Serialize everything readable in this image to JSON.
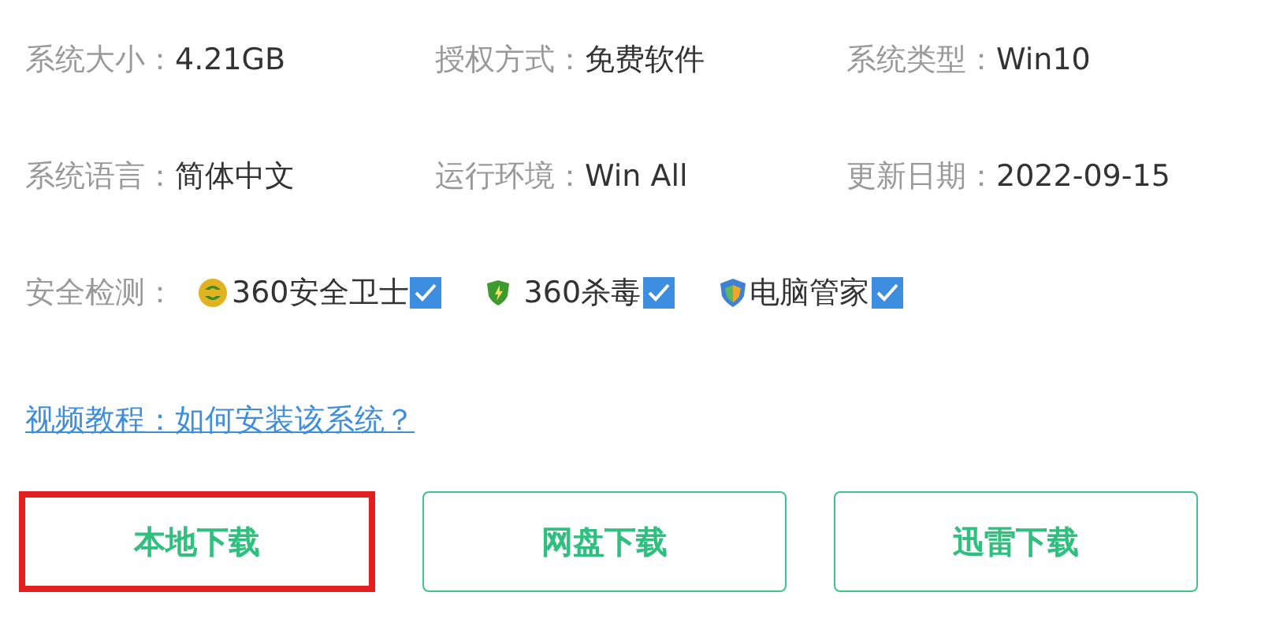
{
  "info_rows": [
    [
      {
        "label": "系统大小：",
        "value": "4.21GB"
      },
      {
        "label": "授权方式：",
        "value": "免费软件"
      },
      {
        "label": "系统类型：",
        "value": "Win10"
      }
    ],
    [
      {
        "label": "系统语言：",
        "value": "简体中文"
      },
      {
        "label": "运行环境：",
        "value": "Win All"
      },
      {
        "label": "更新日期：",
        "value": "2022-09-15"
      }
    ]
  ],
  "security": {
    "label": "安全检测：",
    "items": [
      {
        "kind": "guard",
        "name": "360安全卫士",
        "checked": true
      },
      {
        "kind": "antivirus",
        "name": "360杀毒",
        "checked": true
      },
      {
        "kind": "manager",
        "name": "电脑管家",
        "checked": true
      }
    ]
  },
  "tutorial_link": "视频教程：如何安装该系统？",
  "buttons": [
    {
      "label": "本地下载",
      "highlighted": true
    },
    {
      "label": "网盘下载",
      "highlighted": false
    },
    {
      "label": "迅雷下载",
      "highlighted": false
    }
  ]
}
